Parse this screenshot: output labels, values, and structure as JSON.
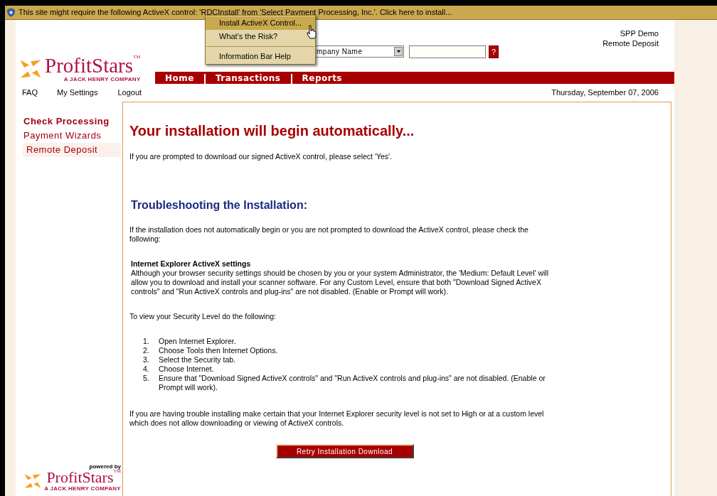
{
  "info_bar": {
    "text": "This site might require the following ActiveX control: 'RDCInstall' from 'Select Payment Processing, Inc.'. Click here to install..."
  },
  "popup_menu": {
    "items": [
      {
        "kind": "item",
        "label": "Install ActiveX Control...",
        "selected": true
      },
      {
        "kind": "item",
        "label": "What's the Risk?",
        "selected": false
      },
      {
        "kind": "separator"
      },
      {
        "kind": "item",
        "label": "Information Bar Help",
        "selected": false
      }
    ]
  },
  "header": {
    "logo": {
      "name": "ProfitStars$^{TM}$",
      "tagline": "A JACK HENRY COMPANY"
    },
    "company_select": {
      "value": "mpany Name"
    },
    "help_button": "?",
    "account": [
      "SPP Demo",
      "Remote Deposit"
    ]
  },
  "nav_tabs": [
    "Home",
    "Transactions",
    "Reports"
  ],
  "links": [
    "FAQ",
    "My Settings",
    "Logout"
  ],
  "date": "Thursday, September 07, 2006",
  "sidebar": {
    "items": [
      {
        "kind": "heading",
        "label": "Check Processing",
        "selected": false
      },
      {
        "kind": "link",
        "label": "Payment Wizards",
        "selected": false
      },
      {
        "kind": "link",
        "label": "Remote Deposit",
        "selected": true
      }
    ],
    "footer_logo": {
      "caption": "powered by",
      "name": "ProfitStars$^{TM}$",
      "tagline": "A JACK HENRY COMPANY"
    }
  },
  "content": {
    "title": "Your installation will begin automatically...",
    "blocks": [
      {
        "kind": "paragraph",
        "text": "If you are prompted to download our signed ActiveX control, please select 'Yes'."
      },
      {
        "kind": "subheading",
        "text": "Troubleshooting the Installation:"
      },
      {
        "kind": "paragraph",
        "text": "If the installation does not automatically begin or you are not prompted to download the ActiveX  control, please check the following:"
      },
      {
        "kind": "section",
        "heading": "Internet Explorer ActiveX settings",
        "text": "Although your browser security settings should be chosen by you or your system Administrator, the 'Medium: Default Level' will allow you to download and install your scanner software. For any Custom Level, ensure that both \"Download Signed ActiveX controls\" and \"Run ActiveX controls and plug-ins\" are not disabled. (Enable or Prompt will work)."
      },
      {
        "kind": "paragraph",
        "text": "To view your Security Level do the following:"
      },
      {
        "kind": "list",
        "items": [
          {
            "number": "1.",
            "text": "Open Internet Explorer."
          },
          {
            "number": "2.",
            "text": "Choose Tools then Internet Options."
          },
          {
            "number": "3.",
            "text": "Select the Security tab."
          },
          {
            "number": "4.",
            "text": "Choose Internet."
          },
          {
            "number": "5.",
            "text": "Ensure that \"Download Signed ActiveX controls\" and \"Run ActiveX controls and plug-ins\" are not disabled. (Enable or Prompt will work)."
          }
        ]
      },
      {
        "kind": "paragraph",
        "text": "If you are having trouble installing make certain that your Internet Explorer security level is not set to High or at a custom level which does not allow downloading or viewing of ActiveX controls."
      }
    ],
    "button": "Retry Installation Download"
  }
}
